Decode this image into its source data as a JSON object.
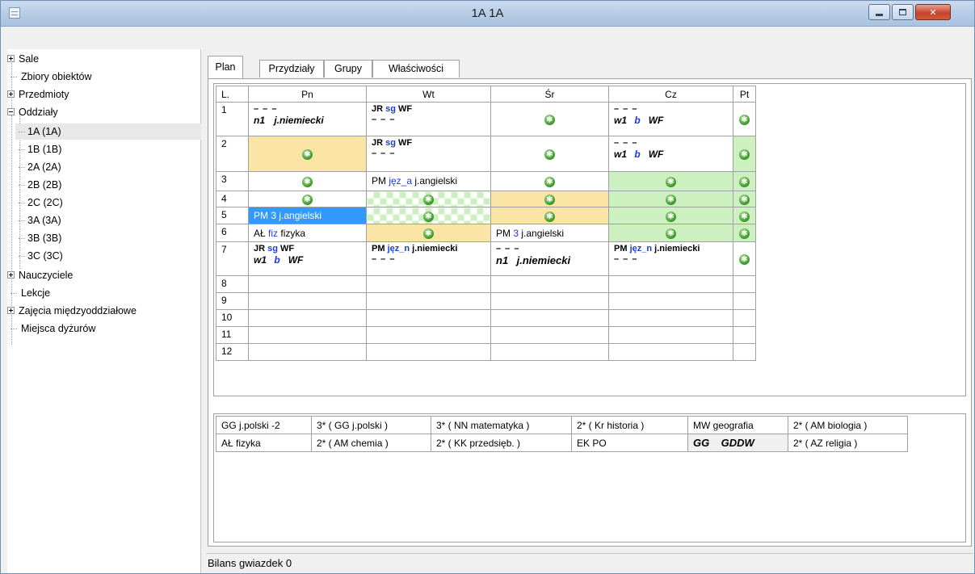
{
  "window": {
    "title": "1A 1A"
  },
  "tree": {
    "items": [
      {
        "label": "Sale",
        "expander": "plus"
      },
      {
        "label": "Zbiory obiektów",
        "expander": "none"
      },
      {
        "label": "Przedmioty",
        "expander": "plus"
      },
      {
        "label": "Oddziały",
        "expander": "minus"
      },
      {
        "label": "1A (1A)",
        "child": true,
        "selected": true
      },
      {
        "label": "1B (1B)",
        "child": true
      },
      {
        "label": "2A (2A)",
        "child": true
      },
      {
        "label": "2B (2B)",
        "child": true
      },
      {
        "label": "2C (2C)",
        "child": true
      },
      {
        "label": "3A (3A)",
        "child": true
      },
      {
        "label": "3B (3B)",
        "child": true
      },
      {
        "label": "3C (3C)",
        "child": true
      },
      {
        "label": "Nauczyciele",
        "expander": "plus"
      },
      {
        "label": "Lekcje",
        "expander": "none"
      },
      {
        "label": "Zajęcia międzyoddziałowe",
        "expander": "plus"
      },
      {
        "label": "Miejsca dyżurów",
        "expander": "none"
      }
    ]
  },
  "tabs": [
    {
      "label": "Plan",
      "active": true
    },
    {
      "label": "Przydziały"
    },
    {
      "label": "Grupy"
    },
    {
      "label": "Właściwości"
    }
  ],
  "plan": {
    "headers": [
      "L.",
      "Pn",
      "Wt",
      "Śr",
      "Cz",
      "Pt"
    ],
    "star_glyph": "✱",
    "dash": "– – –",
    "rows": [
      {
        "n": "1",
        "pn": {
          "a": "",
          "b": "n1",
          "c": "j.niemiecki"
        },
        "wt": {
          "t": "JR",
          "g": "sg",
          "s": "WF"
        },
        "cz": {
          "a": "",
          "b": "w1",
          "g": "b",
          "c": "WF"
        }
      },
      {
        "n": "2",
        "wt": {
          "t": "JR",
          "g": "sg",
          "s": "WF"
        },
        "cz": {
          "b": "w1",
          "g": "b",
          "c": "WF"
        }
      },
      {
        "n": "3",
        "wt": {
          "t": "PM",
          "g": "jęz_a",
          "s": "j.angielski"
        }
      },
      {
        "n": "4"
      },
      {
        "n": "5",
        "pn": {
          "t": "PM",
          "g": "3",
          "s": "j.angielski"
        }
      },
      {
        "n": "6",
        "pn": {
          "t": "AŁ",
          "g": "fiz",
          "s": "fizyka"
        },
        "sr": {
          "t": "PM",
          "g": "3",
          "s": "j.angielski"
        }
      },
      {
        "n": "7",
        "pn": {
          "t": "JR",
          "g": "sg",
          "s": "WF",
          "b": "w1",
          "g2": "b",
          "c": "WF"
        },
        "wt": {
          "t": "PM",
          "g": "jęz_n",
          "s": "j.niemiecki"
        },
        "sr": {
          "b": "n1",
          "c": "j.niemiecki"
        },
        "cz": {
          "t": "PM",
          "g": "jęz_n",
          "s": "j.niemiecki"
        }
      },
      {
        "n": "8"
      },
      {
        "n": "9"
      },
      {
        "n": "10"
      },
      {
        "n": "11"
      },
      {
        "n": "12"
      }
    ]
  },
  "lessons": {
    "row1": [
      "GG j.polski -2",
      "3* ( GG j.polski )",
      "3* ( NN matematyka )",
      "2* ( Kr historia )",
      "MW geografia",
      "2* ( AM biologia )"
    ],
    "row2": [
      "AŁ fizyka",
      "2* ( AM chemia )",
      "2* ( KK przedsięb. )",
      "EK PO",
      "GG    GDDW",
      "2* ( AZ religia )"
    ]
  },
  "status": {
    "text": "Bilans gwiazdek 0"
  },
  "colors": {
    "yellow": "#fbe5a6",
    "green": "#cdf0c0",
    "selected": "#3399ff",
    "group_blue": "#1a3bd8"
  }
}
